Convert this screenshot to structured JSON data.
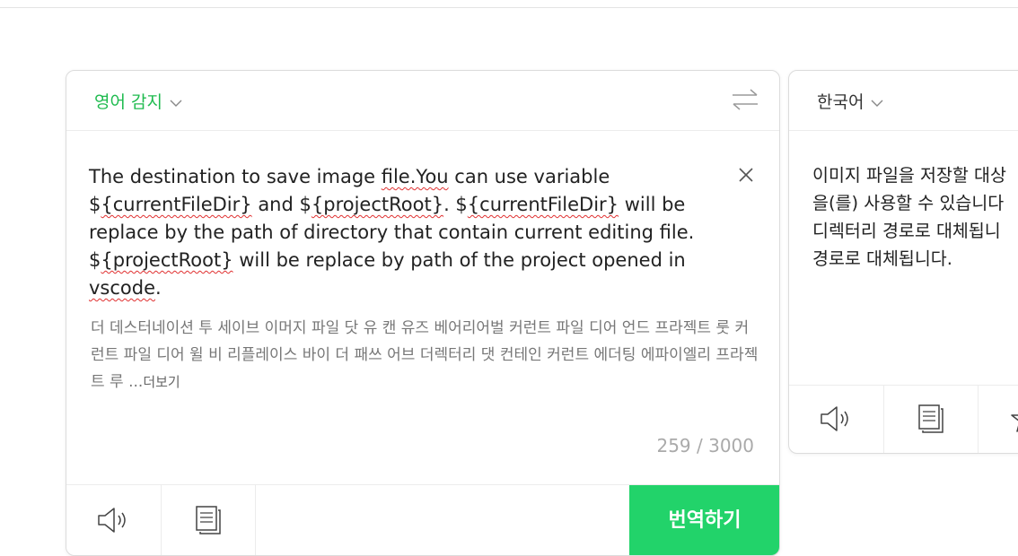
{
  "source": {
    "language": "영어 감지",
    "text_segments": [
      {
        "t": "The destination to save image ",
        "sq": false
      },
      {
        "t": "file.You",
        "sq": true
      },
      {
        "t": " can use variable $",
        "sq": false
      },
      {
        "t": "{currentFileDir}",
        "sq": true
      },
      {
        "t": " and $",
        "sq": false
      },
      {
        "t": "{projectRoot}",
        "sq": true
      },
      {
        "t": ". $",
        "sq": false
      },
      {
        "t": "{currentFileDir}",
        "sq": true
      },
      {
        "t": " will be replace by the path of directory that contain current editing file. $",
        "sq": false
      },
      {
        "t": "{projectRoot}",
        "sq": true
      },
      {
        "t": " will be replace by path of the project opened in ",
        "sq": false
      },
      {
        "t": "vscode",
        "sq": true
      },
      {
        "t": ".",
        "sq": false
      }
    ],
    "pronunciation": "더 데스터네이션 투 세이브 이머지 파일 닷 유 캔 유즈 베어리어벌 커런트 파일 디어 언드 프라젝트 룻 커런트 파일 디어 윌 비 리플레이스 바이 더 패쓰 어브 더렉터리 댓 컨테인 커런트 에더팅 에파이엘리 프라젝트 루 ...",
    "more_label": "더보기",
    "counter": "259 / 3000",
    "translate_label": "번역하기"
  },
  "target": {
    "language": "한국어",
    "lines": [
      "이미지 파일을 저장할 대상",
      "을(를) 사용할 수 있습니다",
      "디렉터리 경로로 대체됩니",
      "경로로 대체됩니다."
    ]
  },
  "icons": {
    "chevron": "chevron-down-icon",
    "swap": "swap-arrows-icon",
    "close": "close-icon",
    "speaker": "speaker-icon",
    "copy": "copy-icon",
    "star": "star-icon"
  },
  "colors": {
    "accent_green": "#1fbb4f",
    "translate_button": "#22d36a",
    "spellcheck_red": "#e03030"
  }
}
